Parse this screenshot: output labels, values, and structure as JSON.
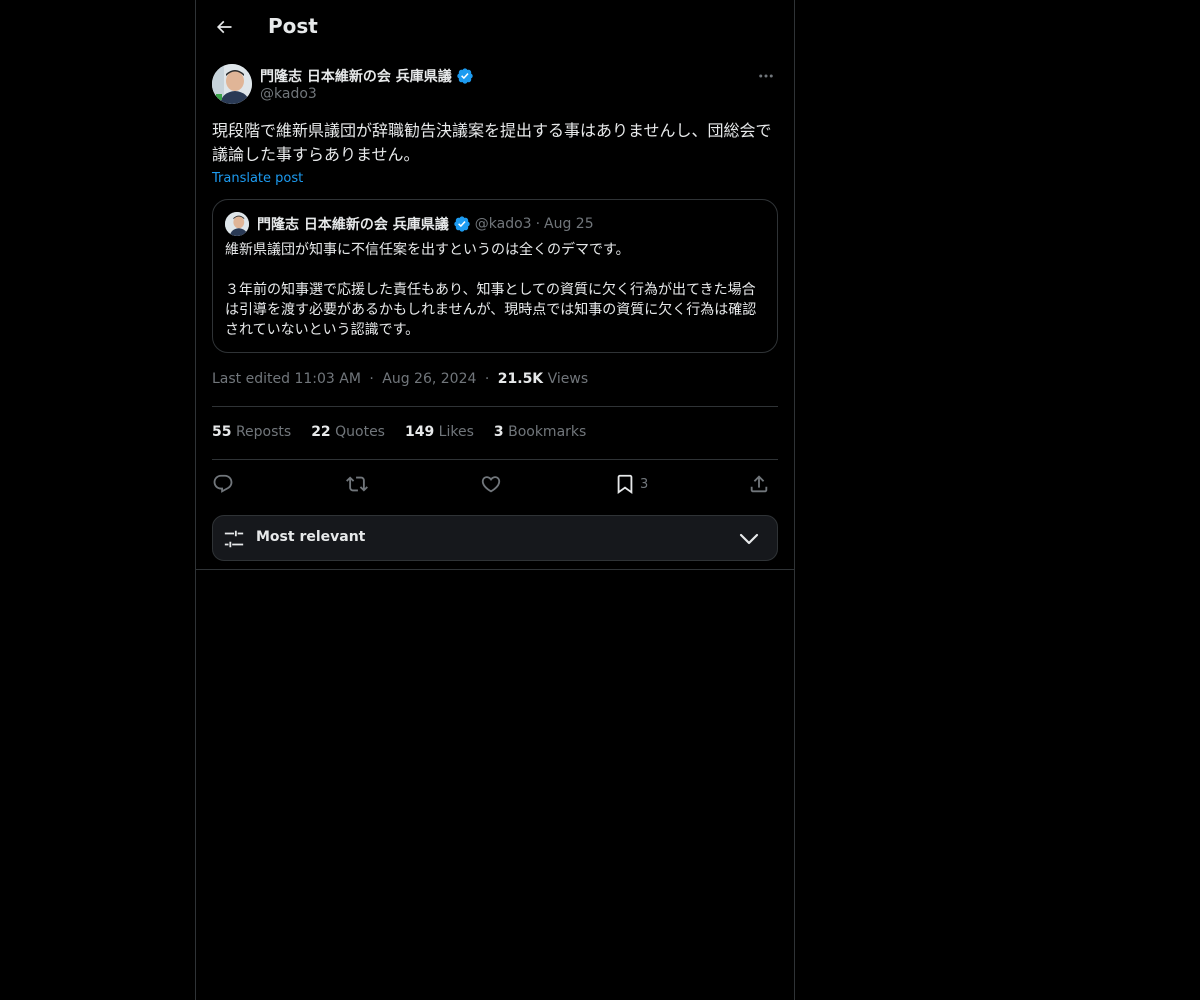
{
  "header": {
    "title": "Post"
  },
  "post": {
    "author": {
      "display_name": "門隆志 日本維新の会 兵庫県議",
      "handle": "@kado3",
      "verified": true
    },
    "text": "現段階で維新県議団が辞職勧告決議案を提出する事はありませんし、団総会で議論した事すらありません。",
    "translate_label": "Translate post",
    "quote": {
      "author": {
        "display_name": "門隆志 日本維新の会 兵庫県議",
        "handle": "@kado3",
        "verified": true
      },
      "separator": "·",
      "date": "Aug 25",
      "paragraph1": "維新県議団が知事に不信任案を出すというのは全くのデマです。",
      "paragraph2": "３年前の知事選で応援した責任もあり、知事としての資質に欠く行為が出てきた場合は引導を渡す必要があるかもしれませんが、現時点では知事の資質に欠く行為は確認されていないという認識です。"
    },
    "meta": {
      "edited_label": "Last edited 11:03 AM",
      "separator": "·",
      "date": "Aug 26, 2024",
      "views_count": "21.5K",
      "views_label": "Views"
    },
    "stats": [
      {
        "count": "55",
        "label": "Reposts"
      },
      {
        "count": "22",
        "label": "Quotes"
      },
      {
        "count": "149",
        "label": "Likes"
      },
      {
        "count": "3",
        "label": "Bookmarks"
      }
    ],
    "actions": {
      "reply_icon": "reply-icon",
      "repost_icon": "repost-icon",
      "like_icon": "heart-icon",
      "bookmark_icon": "bookmark-icon",
      "bookmark_count": "3",
      "share_icon": "share-icon"
    }
  },
  "sort": {
    "label": "Most relevant"
  },
  "colors": {
    "accent": "#1d9bf0",
    "muted": "#71767b",
    "text": "#e7e9ea",
    "border": "#2f3336"
  }
}
